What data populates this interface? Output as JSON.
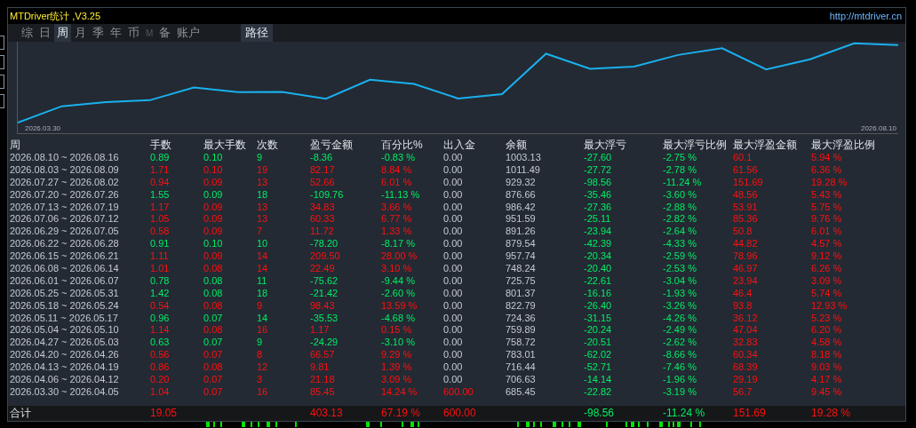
{
  "window": {
    "title": "MTDriver统计 ,V3.25",
    "link": "http://mtdriver.cn"
  },
  "tabs": [
    {
      "label": "综",
      "selected": false,
      "disabled": false
    },
    {
      "label": "日",
      "selected": false,
      "disabled": false
    },
    {
      "label": "周",
      "selected": true,
      "disabled": false
    },
    {
      "label": "月",
      "selected": false,
      "disabled": false
    },
    {
      "label": "季",
      "selected": false,
      "disabled": false
    },
    {
      "label": "年",
      "selected": false,
      "disabled": false
    },
    {
      "label": "币",
      "selected": false,
      "disabled": false
    },
    {
      "label": "M",
      "selected": false,
      "disabled": true
    },
    {
      "label": "备",
      "selected": false,
      "disabled": false
    },
    {
      "label": "账户",
      "selected": false,
      "disabled": false
    }
  ],
  "path_button": "路径",
  "chart": {
    "start_label": "2026.03.30",
    "end_label": "2026.08.10"
  },
  "table": {
    "columns": [
      "周",
      "手数",
      "最大手数",
      "次数",
      "盈亏金额",
      "百分比%",
      "出入金",
      "余额",
      "最大浮亏",
      "最大浮亏比例",
      "最大浮盈金额",
      "最大浮盈比例"
    ],
    "rows": [
      {
        "kind": "loss",
        "deposit": false,
        "cells": [
          "2026.08.10 ~ 2026.08.16",
          "0.89",
          "0.10",
          "9",
          "-8.36",
          "-0.83 %",
          "0.00",
          "1003.13",
          "-27.60",
          "-2.75 %",
          "60.1",
          "5.94 %"
        ]
      },
      {
        "kind": "gain",
        "deposit": false,
        "cells": [
          "2026.08.03 ~ 2026.08.09",
          "1.71",
          "0.10",
          "19",
          "82.17",
          "8.84 %",
          "0.00",
          "1011.49",
          "-27.72",
          "-2.78 %",
          "61.56",
          "6.36 %"
        ]
      },
      {
        "kind": "gain",
        "deposit": false,
        "cells": [
          "2026.07.27 ~ 2026.08.02",
          "0.94",
          "0.09",
          "13",
          "52.66",
          "6.01 %",
          "0.00",
          "929.32",
          "-98.56",
          "-11.24 %",
          "151.69",
          "19.28 %"
        ]
      },
      {
        "kind": "loss",
        "deposit": false,
        "cells": [
          "2026.07.20 ~ 2026.07.26",
          "1.55",
          "0.09",
          "18",
          "-109.76",
          "-11.13 %",
          "0.00",
          "876.66",
          "-35.46",
          "-3.60 %",
          "48.56",
          "5.43 %"
        ]
      },
      {
        "kind": "gain",
        "deposit": false,
        "cells": [
          "2026.07.13 ~ 2026.07.19",
          "1.17",
          "0.09",
          "13",
          "34.83",
          "3.66 %",
          "0.00",
          "986.42",
          "-27.36",
          "-2.88 %",
          "53.91",
          "5.75 %"
        ]
      },
      {
        "kind": "gain",
        "deposit": false,
        "cells": [
          "2026.07.06 ~ 2026.07.12",
          "1.05",
          "0.09",
          "13",
          "60.33",
          "6.77 %",
          "0.00",
          "951.59",
          "-25.11",
          "-2.82 %",
          "85.36",
          "9.76 %"
        ]
      },
      {
        "kind": "gain",
        "deposit": false,
        "cells": [
          "2026.06.29 ~ 2026.07.05",
          "0.58",
          "0.09",
          "7",
          "11.72",
          "1.33 %",
          "0.00",
          "891.26",
          "-23.94",
          "-2.64 %",
          "50.8",
          "6.01 %"
        ]
      },
      {
        "kind": "loss",
        "deposit": false,
        "cells": [
          "2026.06.22 ~ 2026.06.28",
          "0.91",
          "0.10",
          "10",
          "-78.20",
          "-8.17 %",
          "0.00",
          "879.54",
          "-42.39",
          "-4.33 %",
          "44.82",
          "4.57 %"
        ]
      },
      {
        "kind": "gain",
        "deposit": false,
        "cells": [
          "2026.06.15 ~ 2026.06.21",
          "1.11",
          "0.09",
          "14",
          "209.50",
          "28.00 %",
          "0.00",
          "957.74",
          "-20.34",
          "-2.59 %",
          "78.96",
          "9.12 %"
        ]
      },
      {
        "kind": "gain",
        "deposit": false,
        "cells": [
          "2026.06.08 ~ 2026.06.14",
          "1.01",
          "0.08",
          "14",
          "22.49",
          "3.10 %",
          "0.00",
          "748.24",
          "-20.40",
          "-2.53 %",
          "46.97",
          "6.26 %"
        ]
      },
      {
        "kind": "loss",
        "deposit": false,
        "cells": [
          "2026.06.01 ~ 2026.06.07",
          "0.78",
          "0.08",
          "11",
          "-75.62",
          "-9.44 %",
          "0.00",
          "725.75",
          "-22.61",
          "-3.04 %",
          "23.94",
          "3.09 %"
        ]
      },
      {
        "kind": "loss",
        "deposit": false,
        "cells": [
          "2026.05.25 ~ 2026.05.31",
          "1.42",
          "0.08",
          "18",
          "-21.42",
          "-2.60 %",
          "0.00",
          "801.37",
          "-16.16",
          "-1.93 %",
          "46.4",
          "5.74 %"
        ]
      },
      {
        "kind": "gain",
        "deposit": false,
        "cells": [
          "2026.05.18 ~ 2026.05.24",
          "0.54",
          "0.08",
          "9",
          "98.43",
          "13.59 %",
          "0.00",
          "822.79",
          "-26.40",
          "-3.26 %",
          "93.8",
          "12.93 %"
        ]
      },
      {
        "kind": "loss",
        "deposit": false,
        "cells": [
          "2026.05.11 ~ 2026.05.17",
          "0.96",
          "0.07",
          "14",
          "-35.53",
          "-4.68 %",
          "0.00",
          "724.36",
          "-31.15",
          "-4.26 %",
          "36.12",
          "5.23 %"
        ]
      },
      {
        "kind": "gain",
        "deposit": false,
        "cells": [
          "2026.05.04 ~ 2026.05.10",
          "1.14",
          "0.08",
          "16",
          "1.17",
          "0.15 %",
          "0.00",
          "759.89",
          "-20.24",
          "-2.49 %",
          "47.04",
          "6.20 %"
        ]
      },
      {
        "kind": "loss",
        "deposit": false,
        "cells": [
          "2026.04.27 ~ 2026.05.03",
          "0.63",
          "0.07",
          "9",
          "-24.29",
          "-3.10 %",
          "0.00",
          "758.72",
          "-20.51",
          "-2.62 %",
          "32.83",
          "4.58 %"
        ]
      },
      {
        "kind": "gain",
        "deposit": false,
        "cells": [
          "2026.04.20 ~ 2026.04.26",
          "0.56",
          "0.07",
          "8",
          "66.57",
          "9.29 %",
          "0.00",
          "783.01",
          "-62.02",
          "-8.66 %",
          "60.34",
          "8.18 %"
        ]
      },
      {
        "kind": "gain",
        "deposit": false,
        "cells": [
          "2026.04.13 ~ 2026.04.19",
          "0.86",
          "0.08",
          "12",
          "9.81",
          "1.39 %",
          "0.00",
          "716.44",
          "-52.71",
          "-7.46 %",
          "68.39",
          "9.03 %"
        ]
      },
      {
        "kind": "gain",
        "deposit": false,
        "cells": [
          "2026.04.06 ~ 2026.04.12",
          "0.20",
          "0.07",
          "3",
          "21.18",
          "3.09 %",
          "0.00",
          "706.63",
          "-14.14",
          "-1.96 %",
          "29.19",
          "4.17 %"
        ]
      },
      {
        "kind": "gain",
        "deposit": true,
        "cells": [
          "2026.03.30 ~ 2026.04.05",
          "1.04",
          "0.07",
          "16",
          "85.45",
          "14.24 %",
          "600.00",
          "685.45",
          "-22.82",
          "-3.19 %",
          "56.7",
          "9.45 %"
        ]
      }
    ]
  },
  "total": {
    "label": "合计",
    "cells": [
      "19.05",
      "",
      "",
      "403.13",
      "67.19 %",
      "600.00",
      "",
      "-98.56",
      "-11.24 %",
      "151.69",
      "19.28 %"
    ]
  }
}
